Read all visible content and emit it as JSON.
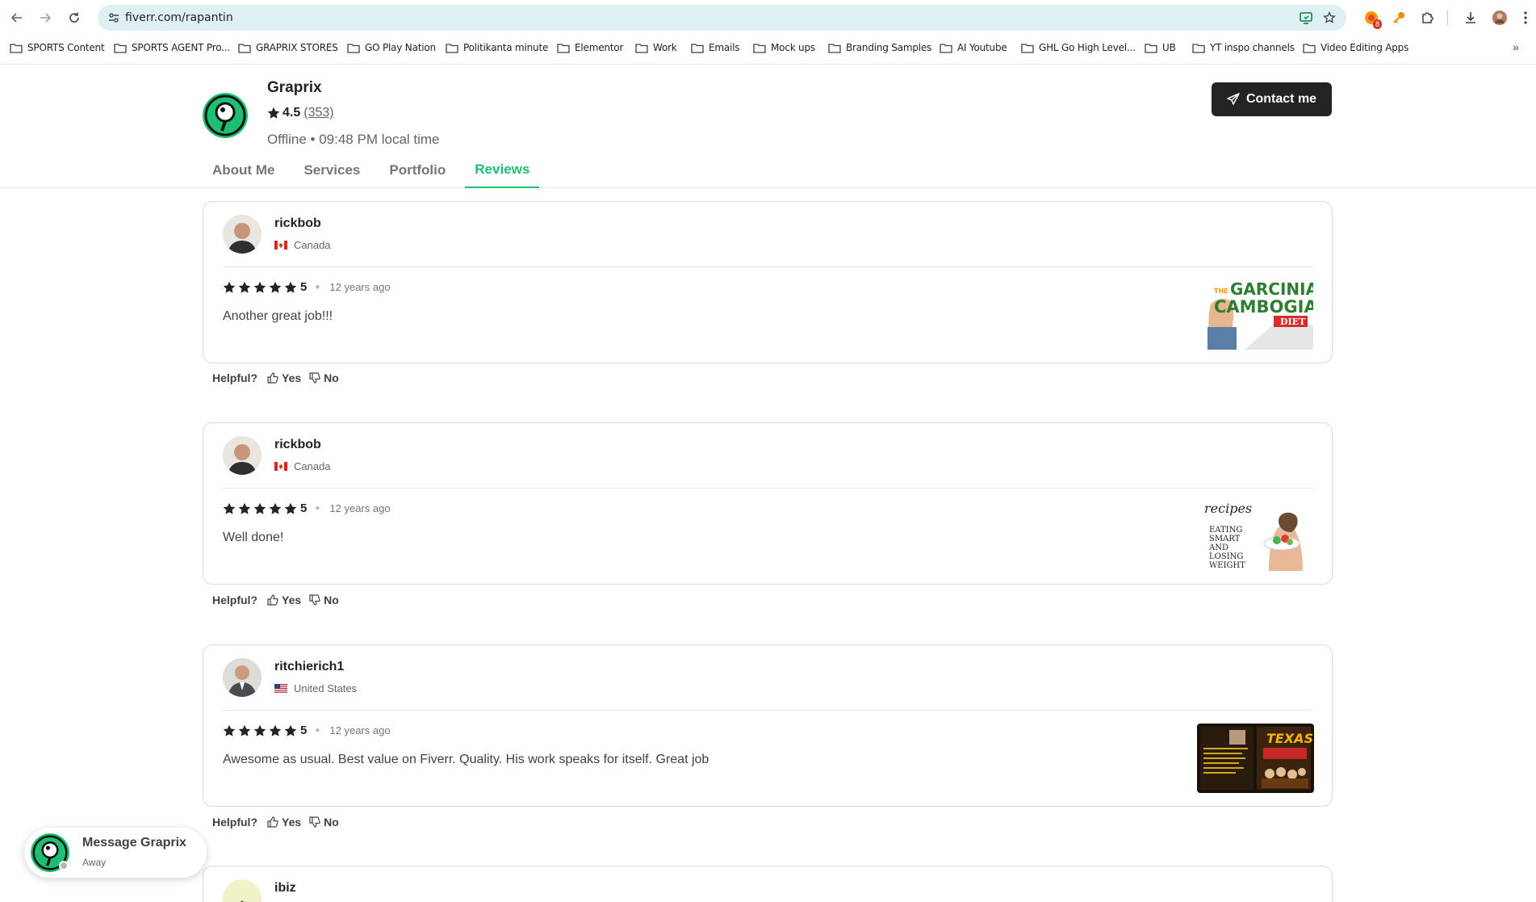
{
  "browser": {
    "url": "fiverr.com/rapantin",
    "bookmarks": [
      "SPORTS Content",
      "SPORTS AGENT Pro...",
      "GRAPRIX STORES",
      "GO Play Nation",
      "Politikanta minute",
      "Elementor",
      "Work",
      "Emails",
      "Mock ups",
      "Branding Samples",
      "AI Youtube",
      "GHL Go High Level...",
      "UB",
      "YT inspo channels",
      "Video Editing Apps"
    ],
    "more": "»",
    "extension_badge": "8"
  },
  "profile": {
    "name": "Graprix",
    "rating": "4.5",
    "rating_count": "(353)",
    "status": "Offline • 09:48 PM local time",
    "contact_label": "Contact me",
    "tabs": [
      "About Me",
      "Services",
      "Portfolio",
      "Reviews"
    ],
    "active_tab": "Reviews"
  },
  "reviews": [
    {
      "name": "rickbob",
      "country": "Canada",
      "stars": "5",
      "ago": "12 years ago",
      "text": "Another great job!!!",
      "thumb": {
        "line1": "THE",
        "line2": "GARCINIA",
        "line3": "CAMBOGIA",
        "line4": "DIET"
      }
    },
    {
      "name": "rickbob",
      "country": "Canada",
      "stars": "5",
      "ago": "12 years ago",
      "text": "Well done!",
      "thumb": {
        "line1": "recipes",
        "line2": "EATING",
        "line3": "SMART",
        "line4": "AND",
        "line5": "LOSING",
        "line6": "WEIGHT"
      }
    },
    {
      "name": "ritchierich1",
      "country": "United States",
      "stars": "5",
      "ago": "12 years ago",
      "text": "Awesome as usual. Best value on Fiverr. Quality. His work speaks for itself. Great job",
      "thumb": {
        "line1": "TEXAS"
      }
    },
    {
      "name": "ibiz",
      "initial": "I"
    }
  ],
  "helpful": {
    "label": "Helpful?",
    "yes": "Yes",
    "no": "No"
  },
  "message": {
    "title": "Message Graprix",
    "status": "Away"
  },
  "colors": {
    "brand": "#1dbf73",
    "dark": "#222325"
  }
}
